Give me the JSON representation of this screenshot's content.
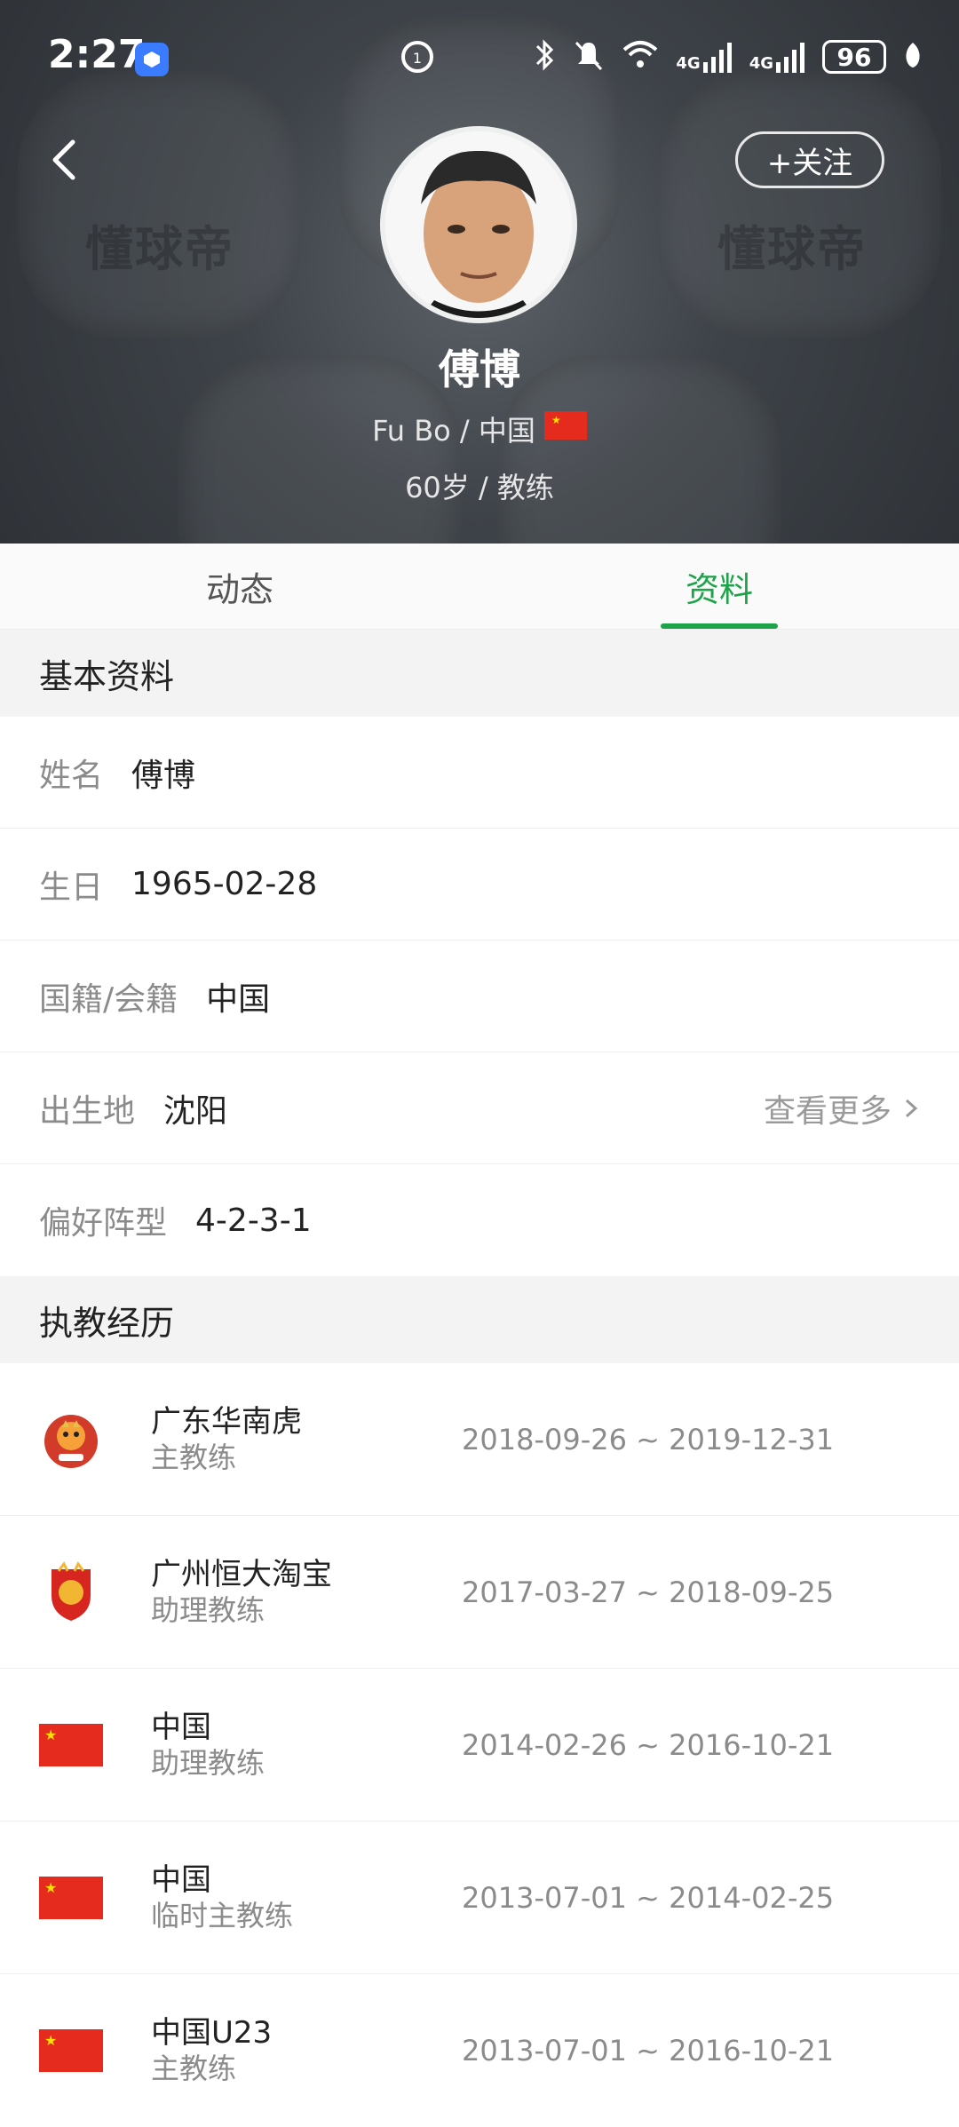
{
  "status_bar": {
    "time": "2:27",
    "battery": "96",
    "net1": "4G",
    "net2": "4G"
  },
  "header": {
    "watermark": "懂球帝",
    "follow_label": "+关注",
    "name": "傅博",
    "subtitle": "Fu Bo / 中国",
    "meta": "60岁 / 教练"
  },
  "tabs": [
    {
      "label": "动态",
      "active": false
    },
    {
      "label": "资料",
      "active": true
    }
  ],
  "basic": {
    "title": "基本资料",
    "rows": [
      {
        "label": "姓名",
        "value": "傅博"
      },
      {
        "label": "生日",
        "value": "1965-02-28"
      },
      {
        "label": "国籍/会籍",
        "value": "中国"
      },
      {
        "label": "出生地",
        "value": "沈阳",
        "more": "查看更多"
      },
      {
        "label": "偏好阵型",
        "value": "4-2-3-1"
      }
    ]
  },
  "career": {
    "title": "执教经历",
    "items": [
      {
        "team": "广东华南虎",
        "role": "主教练",
        "dates": "2018-09-26 ~ 2019-12-31",
        "logo": "tiger-club-crest"
      },
      {
        "team": "广州恒大淘宝",
        "role": "助理教练",
        "dates": "2017-03-27 ~ 2018-09-25",
        "logo": "evergrande-crest"
      },
      {
        "team": "中国",
        "role": "助理教练",
        "dates": "2014-02-26 ~ 2016-10-21",
        "logo": "china-flag"
      },
      {
        "team": "中国",
        "role": "临时主教练",
        "dates": "2013-07-01 ~ 2014-02-25",
        "logo": "china-flag"
      },
      {
        "team": "中国U23",
        "role": "主教练",
        "dates": "2013-07-01 ~ 2016-10-21",
        "logo": "china-flag"
      }
    ]
  },
  "colors": {
    "accent": "#1fa34a",
    "header_bg": "#3e4349"
  }
}
